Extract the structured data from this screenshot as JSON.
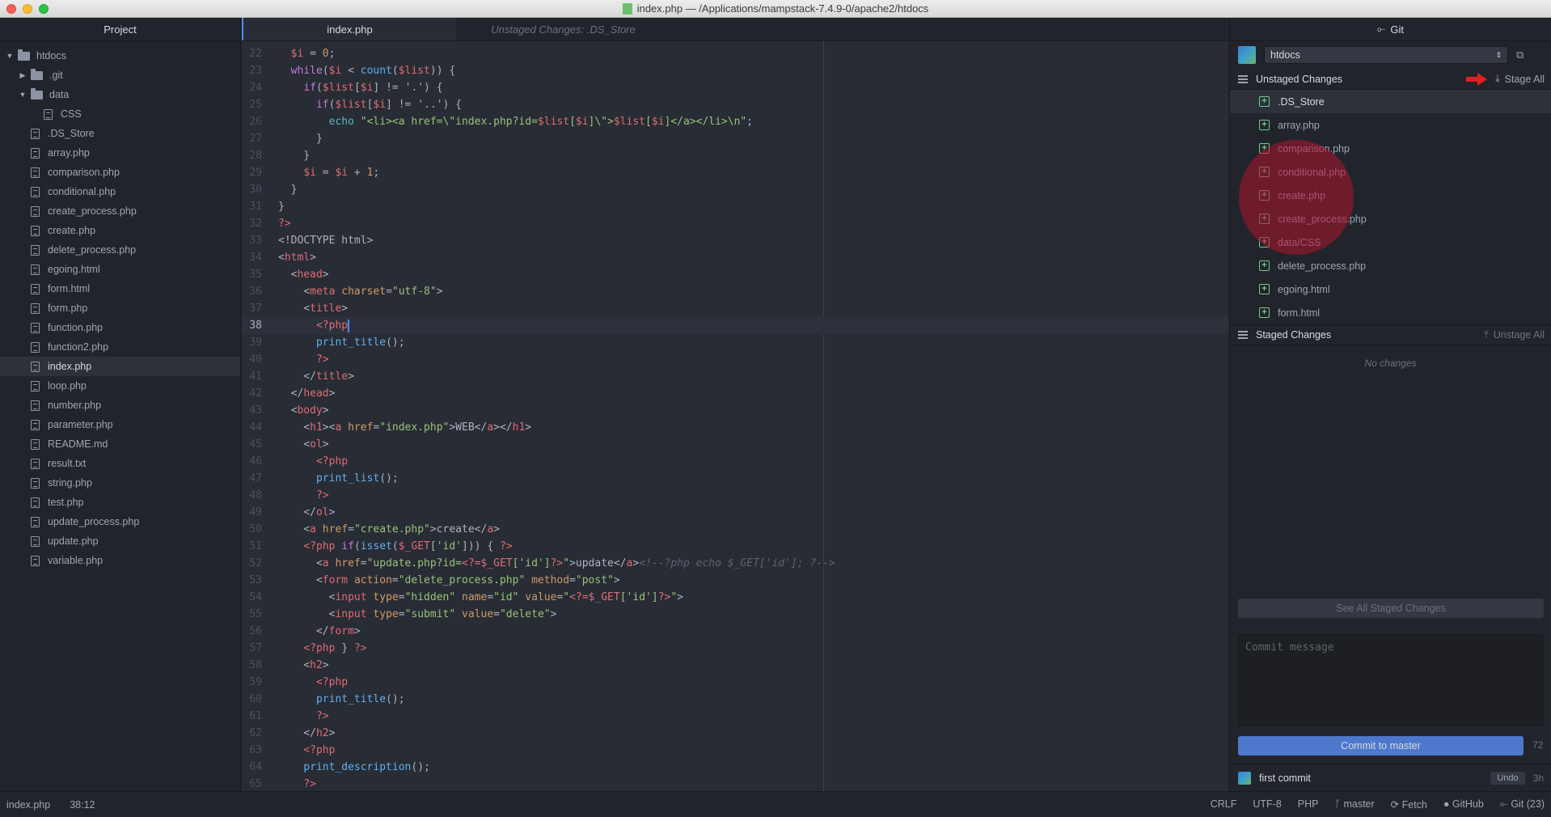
{
  "window": {
    "title": "index.php — /Applications/mampstack-7.4.9-0/apache2/htdocs"
  },
  "tree": {
    "header": "Project",
    "root": "htdocs",
    "folders": [
      ".git",
      "data",
      "CSS"
    ],
    "files": [
      ".DS_Store",
      "array.php",
      "comparison.php",
      "conditional.php",
      "create_process.php",
      "create.php",
      "delete_process.php",
      "egoing.html",
      "form.html",
      "form.php",
      "function.php",
      "function2.php",
      "index.php",
      "loop.php",
      "number.php",
      "parameter.php",
      "README.md",
      "result.txt",
      "string.php",
      "test.php",
      "update_process.php",
      "update.php",
      "variable.php"
    ]
  },
  "editor": {
    "tabs": [
      "index.php",
      "Unstaged Changes: .DS_Store"
    ],
    "line_numbers": [
      "22",
      "23",
      "24",
      "25",
      "26",
      "27",
      "28",
      "29",
      "30",
      "31",
      "32",
      "33",
      "34",
      "35",
      "36",
      "37",
      "38",
      "39",
      "40",
      "41",
      "42",
      "43",
      "44",
      "45",
      "46",
      "47",
      "48",
      "49",
      "50",
      "51",
      "52",
      "53",
      "54",
      "55",
      "56",
      "57",
      "58",
      "59",
      "60",
      "61",
      "62",
      "63",
      "64",
      "65"
    ],
    "cursor_line": "38"
  },
  "git": {
    "header": "Git",
    "repo": "htdocs",
    "unstaged_title": "Unstaged Changes",
    "stage_all": "Stage All",
    "unstaged": [
      ".DS_Store",
      "array.php",
      "comparison.php",
      "conditional.php",
      "create.php",
      "create_process.php",
      "data/CSS",
      "delete_process.php",
      "egoing.html",
      "form.html"
    ],
    "staged_title": "Staged Changes",
    "unstage_all": "Unstage All",
    "no_changes": "No changes",
    "see_all": "See All Staged Changes",
    "commit_placeholder": "Commit message",
    "commit_button": "Commit to master",
    "char_count": "72",
    "last_commit": "first commit",
    "undo": "Undo",
    "ago": "3h"
  },
  "status": {
    "file": "index.php",
    "position": "38:12",
    "line_ending": "CRLF",
    "encoding": "UTF-8",
    "grammar": "PHP",
    "branch": "master",
    "fetch": "Fetch",
    "github": "GitHub",
    "git": "Git (23)"
  },
  "colors": {
    "accent": "#4d78cc",
    "highlight": "#af142d",
    "added": "#73c990"
  }
}
